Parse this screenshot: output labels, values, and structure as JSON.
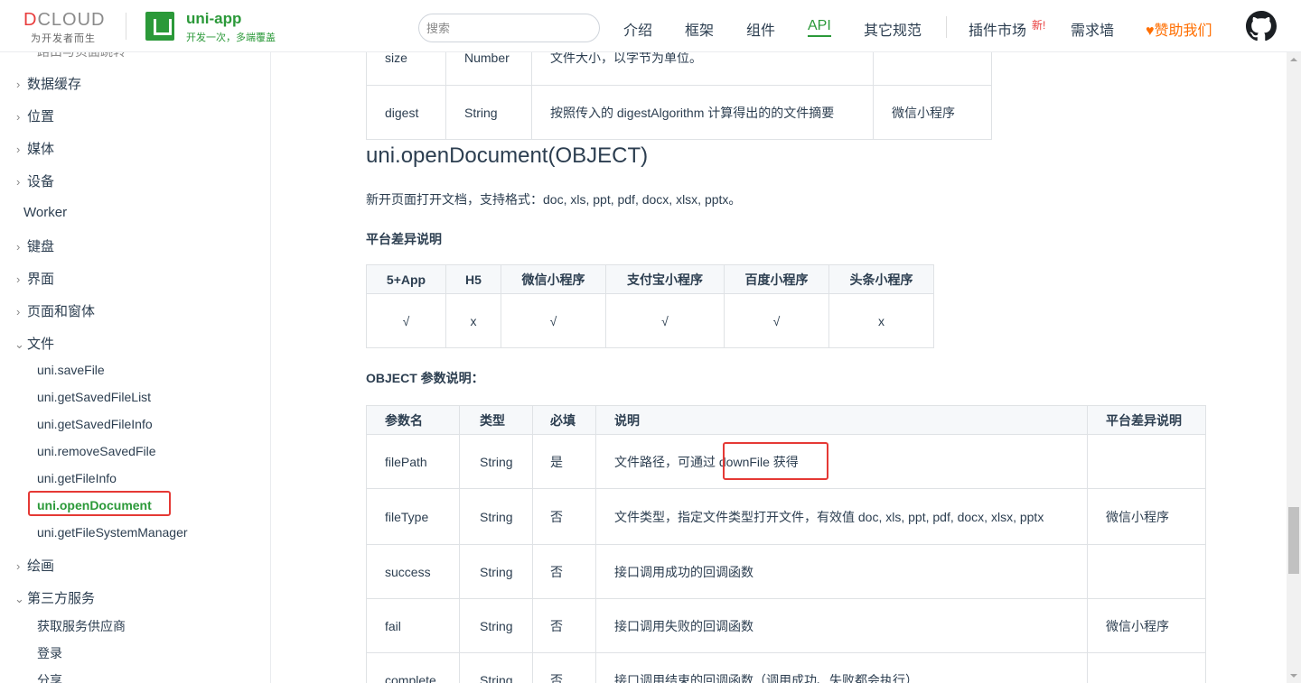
{
  "header": {
    "dcloud_logo": "DCLOUD",
    "dcloud_slogan": "为开发者而生",
    "app_title": "uni-app",
    "app_subtitle": "开发一次，多端覆盖",
    "search_placeholder": "搜索",
    "nav": [
      "介绍",
      "框架",
      "组件",
      "API",
      "其它规范",
      "插件市场",
      "需求墙"
    ],
    "active_nav": "API",
    "new_badge": "新!",
    "sponsor": "♥赞助我们"
  },
  "sidebar": {
    "top_partial": "路由与页面跳转",
    "sections": [
      "数据缓存",
      "位置",
      "媒体",
      "设备",
      "Worker",
      "键盘",
      "界面",
      "页面和窗体",
      "文件"
    ],
    "file_items": [
      "uni.saveFile",
      "uni.getSavedFileList",
      "uni.getSavedFileInfo",
      "uni.removeSavedFile",
      "uni.getFileInfo",
      "uni.openDocument",
      "uni.getFileSystemManager"
    ],
    "after": [
      "绘画",
      "第三方服务"
    ],
    "third_items": [
      "获取服务供应商",
      "登录",
      "分享"
    ]
  },
  "top_table": {
    "rows": [
      [
        "size",
        "Number",
        "文件大小，以字节为单位。",
        ""
      ],
      [
        "digest",
        "String",
        "按照传入的 digestAlgorithm 计算得出的的文件摘要",
        "微信小程序"
      ]
    ]
  },
  "main": {
    "title": "uni.openDocument(OBJECT)",
    "desc": "新开页面打开文档，支持格式：doc, xls, ppt, pdf, docx, xlsx, pptx。",
    "platform_heading": "平台差异说明",
    "platform_headers": [
      "5+App",
      "H5",
      "微信小程序",
      "支付宝小程序",
      "百度小程序",
      "头条小程序"
    ],
    "platform_values": [
      "√",
      "x",
      "√",
      "√",
      "√",
      "x"
    ],
    "param_heading": "OBJECT 参数说明：",
    "param_headers": [
      "参数名",
      "类型",
      "必填",
      "说明",
      "平台差异说明"
    ],
    "params": [
      [
        "filePath",
        "String",
        "是",
        "文件路径，可通过 downFile 获得",
        ""
      ],
      [
        "fileType",
        "String",
        "否",
        "文件类型，指定文件类型打开文件，有效值 doc, xls, ppt, pdf, docx, xlsx, pptx",
        "微信小程序"
      ],
      [
        "success",
        "String",
        "否",
        "接口调用成功的回调函数",
        ""
      ],
      [
        "fail",
        "String",
        "否",
        "接口调用失败的回调函数",
        "微信小程序"
      ],
      [
        "complete",
        "String",
        "否",
        "接口调用结束的回调函数（调用成功、失败都会执行）",
        ""
      ]
    ]
  }
}
